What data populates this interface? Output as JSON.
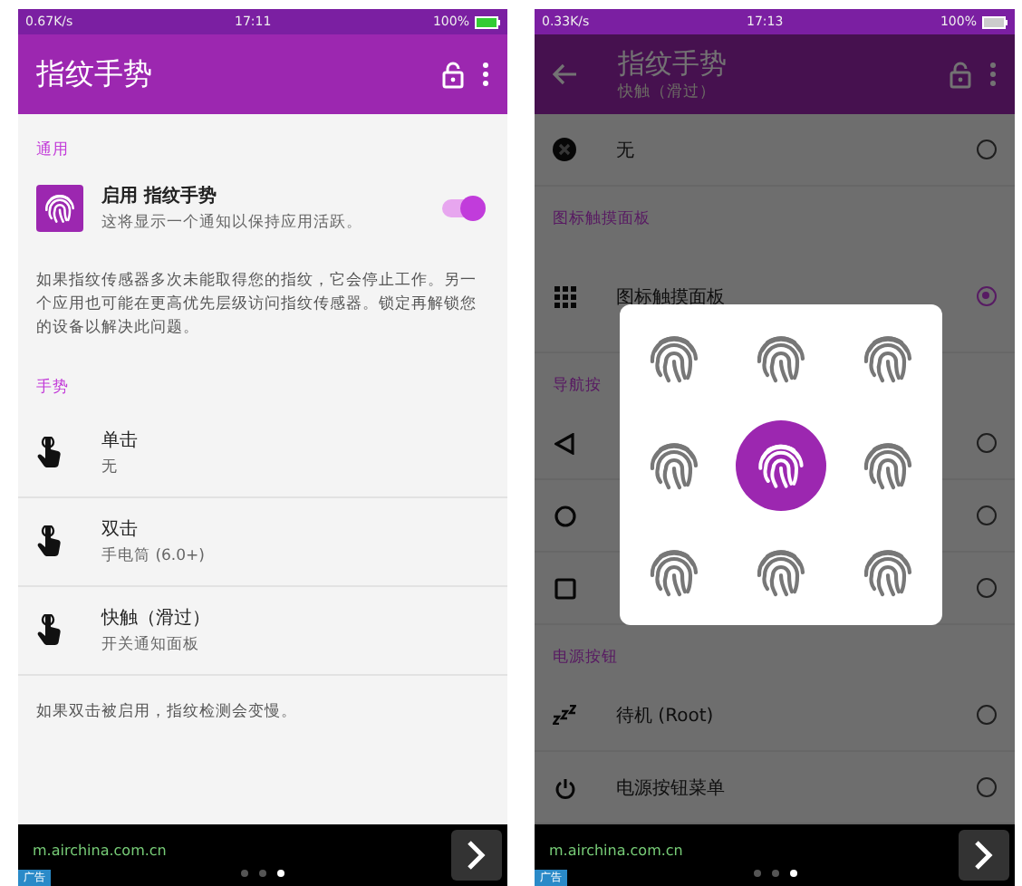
{
  "left_screen": {
    "status_bar": {
      "speed": "0.67K/s",
      "time": "17:11",
      "battery": "100%"
    },
    "app_bar": {
      "title": "指纹手势"
    },
    "sections": [
      {
        "header": "通用",
        "items": [
          {
            "kind": "toggle",
            "title": "启用 指纹手势",
            "subtitle": "这将显示一个通知以保持应用活跃。",
            "on": true
          }
        ],
        "note": "如果指纹传感器多次未能取得您的指纹，它会停止工作。另一个应用也可能在更高优先层级访问指纹传感器。锁定再解锁您的设备以解决此问题。"
      },
      {
        "header": "手势",
        "items": [
          {
            "kind": "gesture",
            "title": "单击",
            "subtitle": "无"
          },
          {
            "kind": "gesture",
            "title": "双击",
            "subtitle": "手电筒 (6.0+)"
          },
          {
            "kind": "gesture",
            "title": "快触（滑过）",
            "subtitle": "开关通知面板"
          }
        ],
        "note": "如果双击被启用，指纹检测会变慢。"
      }
    ],
    "ad_bar": {
      "url": "m.airchina.com.cn",
      "badge": "广告",
      "pages": [
        {
          "selected": false
        },
        {
          "selected": false
        },
        {
          "selected": true
        }
      ]
    }
  },
  "right_screen": {
    "status_bar": {
      "speed": "0.33K/s",
      "time": "17:13",
      "battery": "100%"
    },
    "app_bar": {
      "title": "指纹手势",
      "subtitle": "快触（滑过）"
    },
    "list": [
      {
        "kind": "option",
        "label": "无",
        "selected": false
      },
      {
        "kind": "header",
        "label": "图标触摸面板"
      },
      {
        "kind": "option",
        "label": "图标触摸面板",
        "selected": true
      },
      {
        "kind": "header",
        "label": "导航按"
      },
      {
        "kind": "option",
        "selected": false
      },
      {
        "kind": "option",
        "selected": false
      },
      {
        "kind": "option",
        "selected": false
      },
      {
        "kind": "header",
        "label": "电源按钮"
      },
      {
        "kind": "option",
        "label": "待机 (Root)",
        "selected": false
      },
      {
        "kind": "option",
        "label": "电源按钮菜单",
        "selected": false
      }
    ],
    "dialog": {
      "scrim": true,
      "items": [
        {
          "selected": false
        },
        {
          "selected": false
        },
        {
          "selected": false
        },
        {
          "selected": false
        },
        {
          "selected": true
        },
        {
          "selected": false
        },
        {
          "selected": false
        },
        {
          "selected": false
        },
        {
          "selected": false
        }
      ]
    },
    "ad_bar": {
      "url": "m.airchina.com.cn",
      "badge": "广告",
      "pages": [
        {
          "selected": false
        },
        {
          "selected": false
        },
        {
          "selected": true
        }
      ]
    }
  }
}
